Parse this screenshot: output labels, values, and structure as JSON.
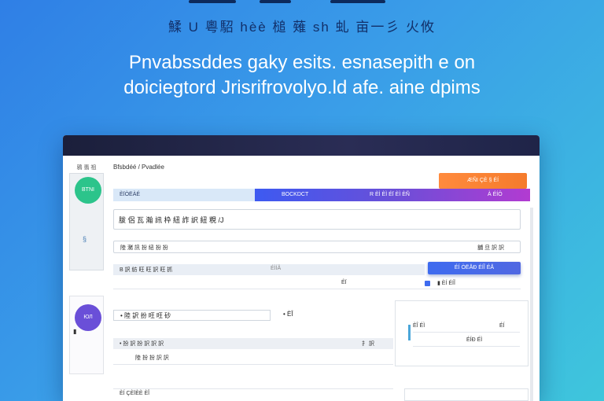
{
  "hero": {
    "subtitle": "鰇 U 粵駋 hèè 槌 薙 sh 虬 亩一彡 火攸",
    "title_line1": "Pnvabssddes gaky esits. esnasepith e on",
    "title_line2": "doiciegtord Jrisrifrovolyo.ld afe. aine dpims"
  },
  "sidebar": {
    "tag": "鴉 翡 祖",
    "badge_top": "BTNI",
    "icon_small": "§",
    "badge_bottom": "ЮЛ",
    "small_text": "▮"
  },
  "main": {
    "breadcrumb": "Bfsbdéé / Pvadlée",
    "orange_button": "ÆÑI  ÇÈ   §  ÉÍ",
    "header": {
      "left": "ÈÏÒËÀÉ",
      "grad_1": "BOCKDCT",
      "grad_2": "R ÈÌ ÈÌ ÉÏ ÈÌ ÈÑ",
      "grad_3": "À  ÉÍÖ"
    },
    "input_big_value": "胈 侶 瓦 瀚 訊 枠 紐 詐 訳 紐 粯 /J",
    "input_small": {
      "label": "陸 瀦 訊 扮 紐 扮 扮",
      "tag": "舖 旦 訳 訳"
    },
    "blue_button": "ÉÍ ÒËÅÐ ÉÍÎ ÉÅ",
    "row_a": {
      "label": "B 訳 紡 旺 旺 訳 旺 抓",
      "right": "ÉÌÍÂ"
    },
    "row_b": {
      "mid": "ÉÏ",
      "right": "▮  ÈÍ ÉÍÎ"
    },
    "row_c": "• 陸 訳 扮 旺 旺 砂",
    "row_c2": "• ÈÎ",
    "row_d": {
      "label": "• 扮 訳 扮 訳 訳 訳",
      "right": "扌 訳"
    },
    "row_e": "陸 扮 扮 訳 訳",
    "row_f": "ÈÍ ÇÈÏÈÈ ÈÎ",
    "preview": {
      "row1": "ÈÎ ÉÌ",
      "row1_right": "ÉÍ",
      "row2": "",
      "row2_right": "ÉÍÐ ÉÌ"
    }
  }
}
